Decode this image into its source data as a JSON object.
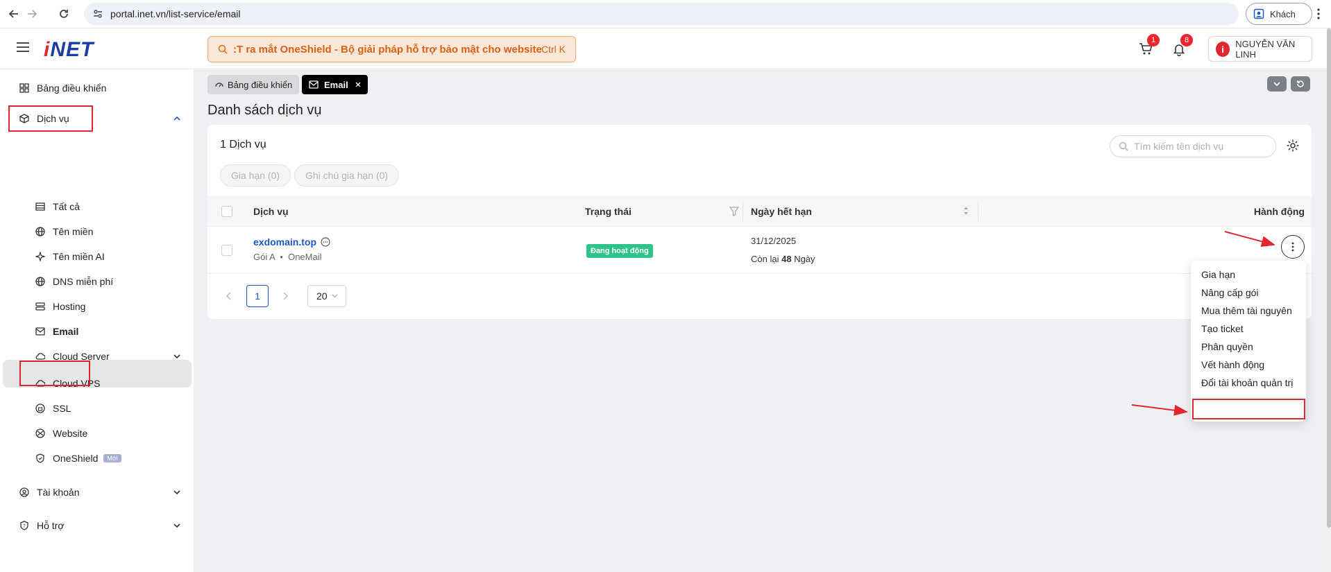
{
  "browser": {
    "url": "portal.inet.vn/list-service/email",
    "guest_label": "Khách"
  },
  "header": {
    "logo_prefix": "i",
    "logo_text": "NET",
    "search_text": "T ra mắt OneShield - Bộ giải pháp hỗ trợ bảo mật cho website",
    "search_prefix": ":",
    "search_shortcut": "Ctrl K",
    "cart_count": "1",
    "notif_count": "8",
    "user_name": "NGUYỄN VĂN LINH"
  },
  "sidebar": {
    "dashboard": "Bảng điều khiển",
    "services": "Dịch vụ",
    "items": [
      {
        "label": "Tất cả",
        "icon": "table-icon"
      },
      {
        "label": "Tên miền",
        "icon": "globe-icon"
      },
      {
        "label": "Tên miền AI",
        "icon": "sparkle-icon"
      },
      {
        "label": "DNS miễn phí",
        "icon": "globe-icon"
      },
      {
        "label": "Hosting",
        "icon": "server-icon"
      },
      {
        "label": "Email",
        "icon": "mail-icon"
      },
      {
        "label": "Cloud Server",
        "icon": "cloud-icon"
      },
      {
        "label": "Cloud VPS",
        "icon": "cloud-icon"
      },
      {
        "label": "SSL",
        "icon": "ssl-icon"
      },
      {
        "label": "Website",
        "icon": "web-icon"
      },
      {
        "label": "OneShield",
        "icon": "shield-icon"
      }
    ],
    "new_tag": "Mới",
    "account": "Tài khoản",
    "support": "Hỗ trợ"
  },
  "tabs": {
    "dashboard": "Bảng điều khiển",
    "email": "Email"
  },
  "page": {
    "title": "Danh sách dịch vụ",
    "count": "1 Dịch vụ",
    "renew_pill": "Gia hạn (0)",
    "note_pill": "Ghi chú gia hạn (0)",
    "search_placeholder": "Tìm kiếm tên dịch vụ"
  },
  "table": {
    "headers": {
      "service": "Dịch vụ",
      "status": "Trạng thái",
      "expiry": "Ngày hết hạn",
      "action": "Hành động"
    },
    "row": {
      "domain": "exdomain.top",
      "package": "Gói A",
      "product": "OneMail",
      "status": "Đang hoạt động",
      "expiry_date": "31/12/2025",
      "remaining_prefix": "Còn lại",
      "remaining_days": "48",
      "remaining_suffix": "Ngày"
    }
  },
  "pagination": {
    "current_page": "1",
    "page_size": "20"
  },
  "action_menu": [
    "Gia hạn",
    "Nâng cấp gói",
    "Mua thêm tài nguyên",
    "Tạo ticket",
    "Phân quyền",
    "Vết hành động",
    "Đổi tài khoản quản trị"
  ],
  "colors": {
    "brand_blue": "#1a3ea6",
    "brand_red": "#e1262d",
    "status_green": "#2dc38b",
    "annotation_red": "#e1262d"
  }
}
